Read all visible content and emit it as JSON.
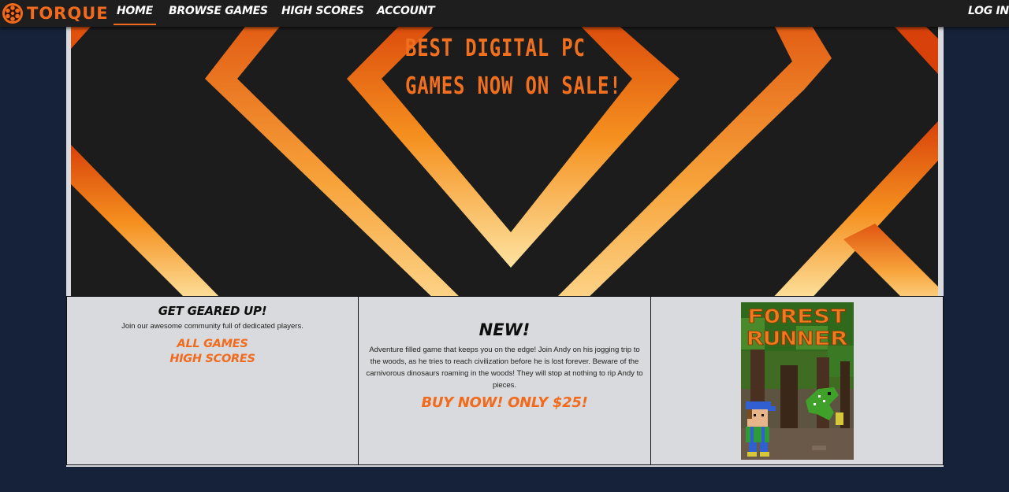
{
  "nav": {
    "logo_text": "TORQUE",
    "links": [
      "HOME",
      "BROWSE GAMES",
      "HIGH SCORES",
      "ACCOUNT"
    ],
    "active": "HOME",
    "login": "LOG IN",
    "accent_color": "#f26a1b"
  },
  "hero": {
    "line1": "BEST DIGITAL PC",
    "line2": "GAMES NOW ON SALE!"
  },
  "card1": {
    "title": "GET GEARED UP!",
    "text": "Join our awesome community full of dedicated players.",
    "link1": "ALL GAMES",
    "link2": "HIGH SCORES"
  },
  "card2": {
    "title": "NEW!",
    "text": "Adventure filled game that keeps you on the edge! Join Andy on his jogging trip to the woods, as he tries to reach civilization before he is lost forever. Beware of the carnivorous dinosaurs roaming in the woods! They will stop at nothing to rip Andy to pieces.",
    "cta": "BUY NOW! ONLY $25!"
  },
  "card3": {
    "cover_title_line1": "FOREST",
    "cover_title_line2": "RUNNER"
  },
  "colors": {
    "page_bg": "#16223a",
    "navbar_bg": "#1e1e1e",
    "hero_bg": "#1c1c1c",
    "card_bg": "#d9dadd"
  }
}
